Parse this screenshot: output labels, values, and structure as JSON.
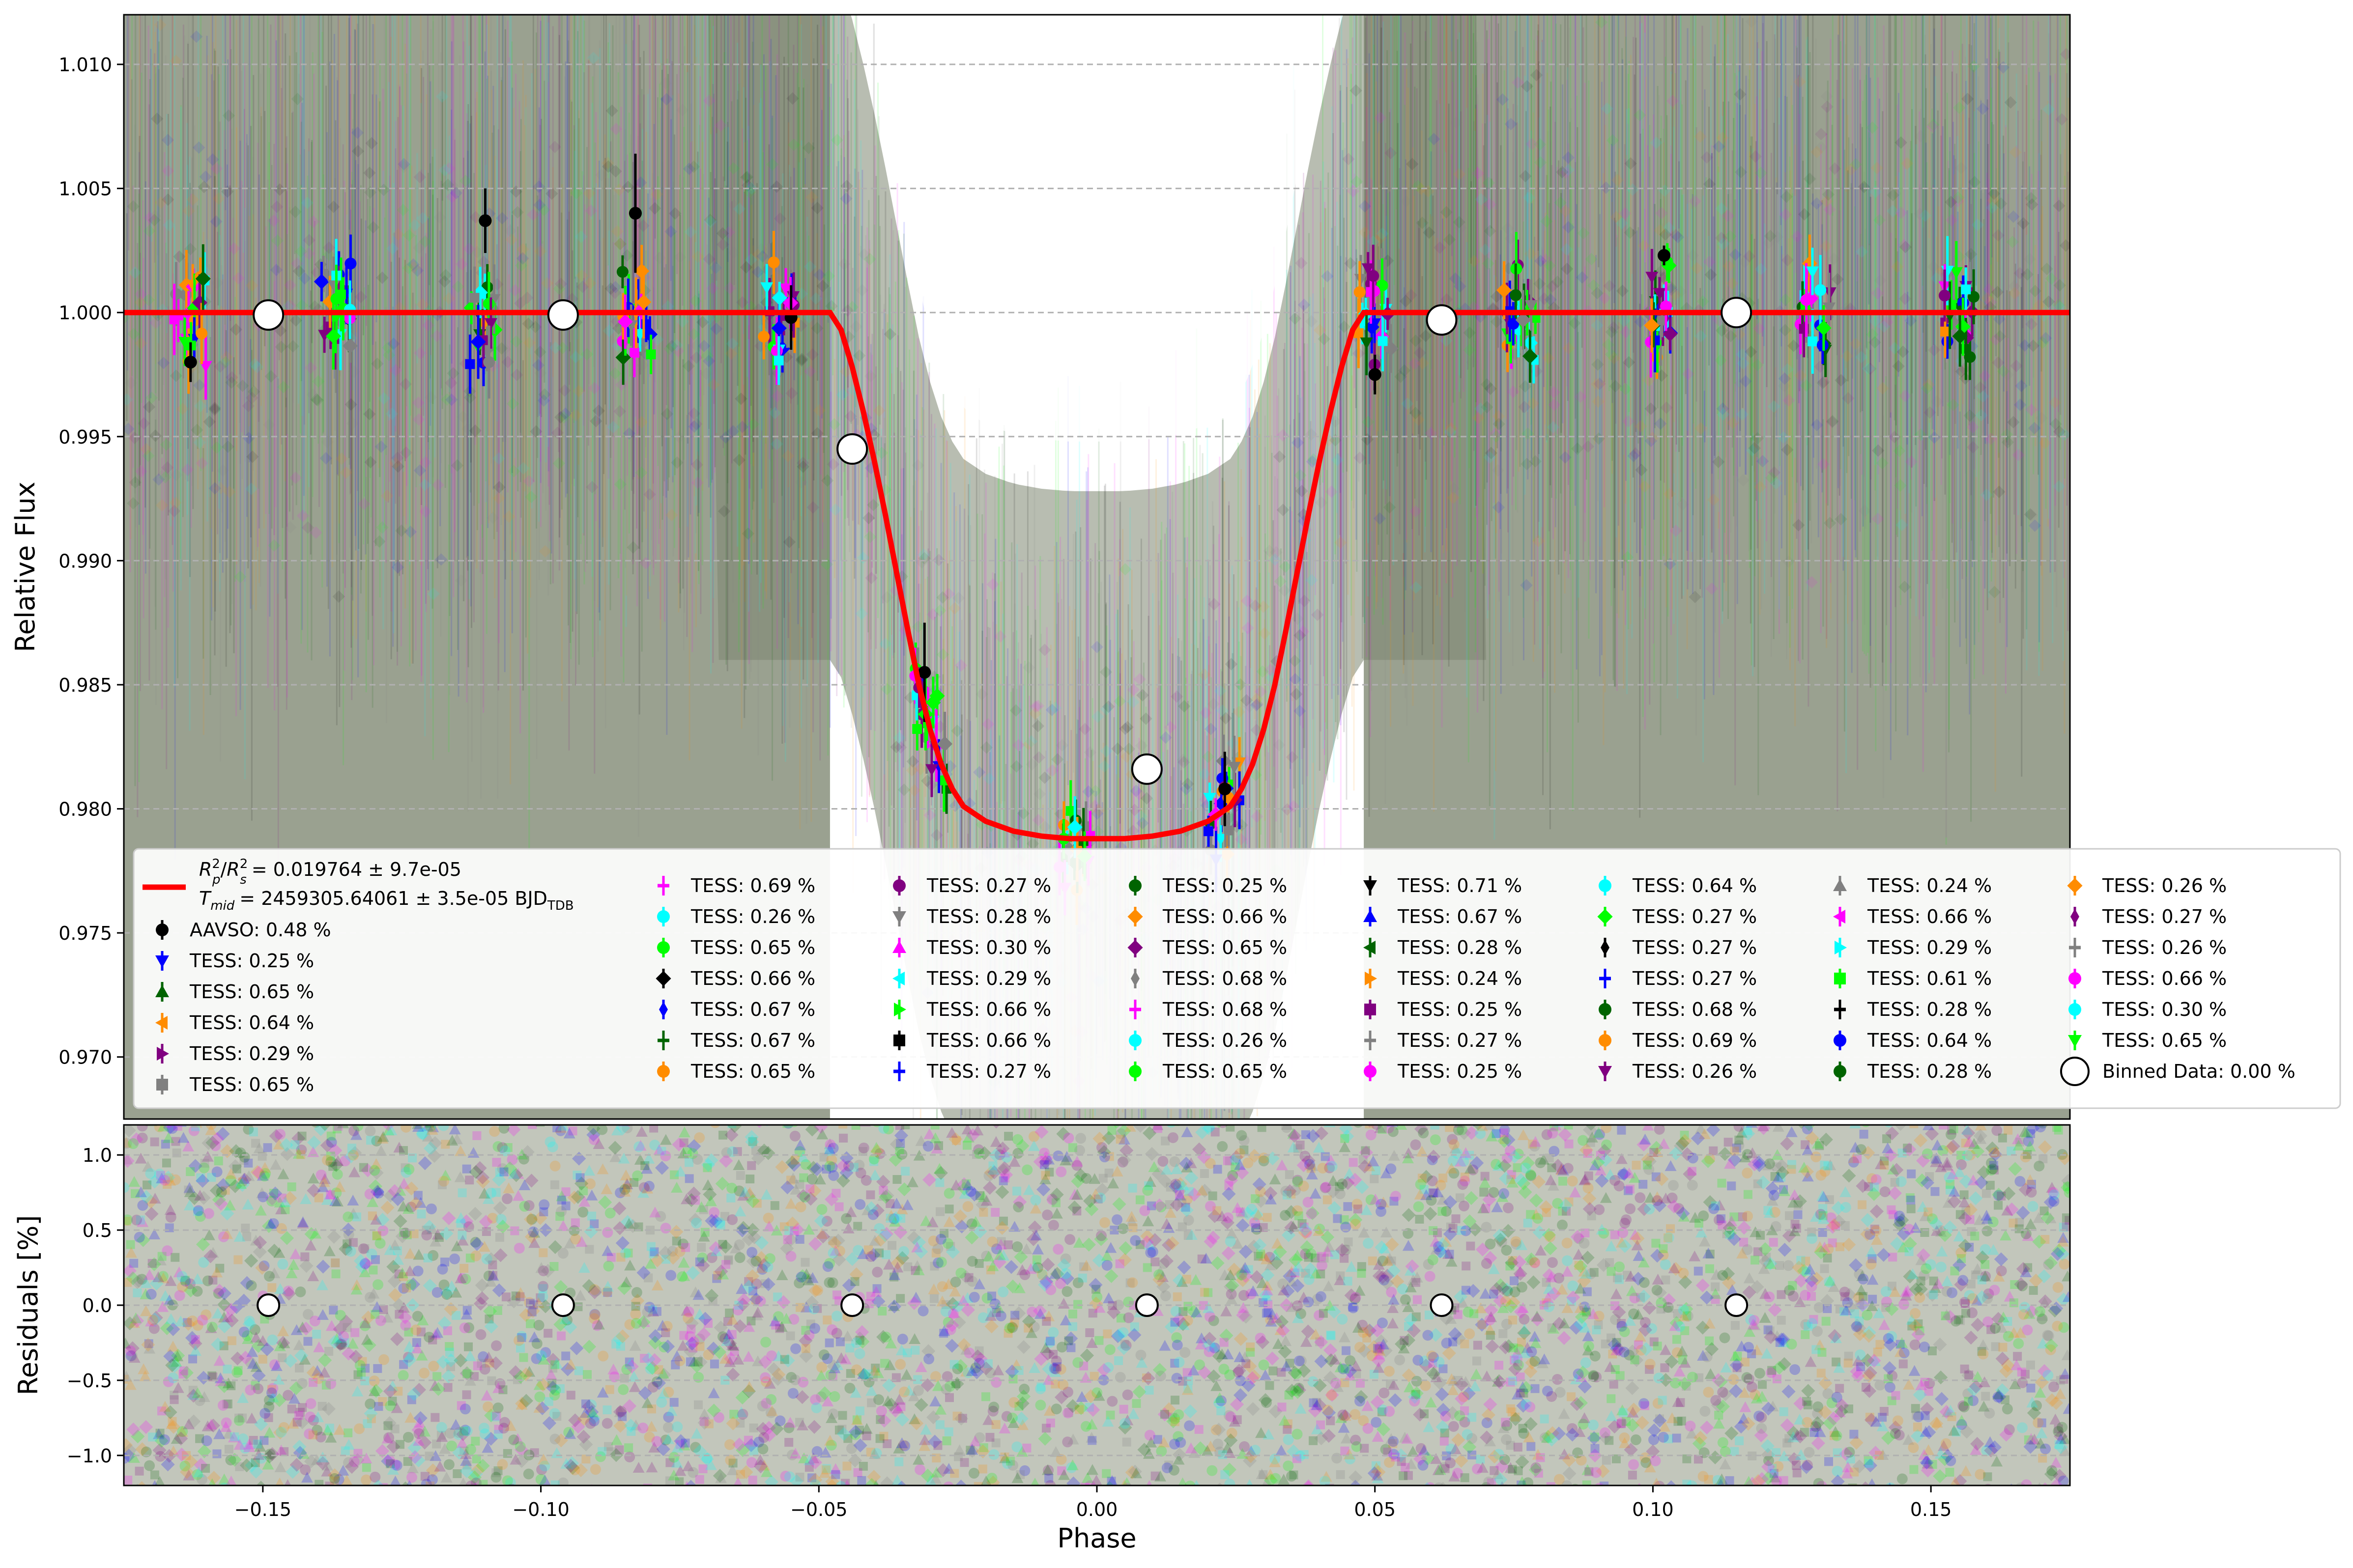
{
  "chart_data": [
    {
      "type": "scatter",
      "panel": "top",
      "xlabel": "",
      "ylabel": "Relative Flux",
      "xlim": [
        -0.175,
        0.175
      ],
      "ylim": [
        0.9675,
        1.012
      ],
      "grid": "horizontal dashed",
      "yticks": [
        "1.010",
        "1.005",
        "1.000",
        "0.995",
        "0.990",
        "0.985",
        "0.980",
        "0.975",
        "0.970"
      ],
      "ytick_values": [
        1.01,
        1.005,
        1.0,
        0.995,
        0.99,
        0.985,
        0.98,
        0.975,
        0.97
      ],
      "model": {
        "name": "transit model",
        "color": "#ff0000",
        "x": [
          -0.175,
          -0.048,
          -0.046,
          -0.044,
          -0.042,
          -0.04,
          -0.038,
          -0.036,
          -0.034,
          -0.032,
          -0.03,
          -0.028,
          -0.026,
          -0.024,
          -0.02,
          -0.015,
          -0.01,
          -0.005,
          0.0,
          0.005,
          0.01,
          0.015,
          0.02,
          0.024,
          0.026,
          0.028,
          0.03,
          0.032,
          0.034,
          0.036,
          0.038,
          0.04,
          0.042,
          0.044,
          0.046,
          0.048,
          0.175
        ],
        "y": [
          1.0,
          1.0,
          0.9993,
          0.9978,
          0.996,
          0.994,
          0.9918,
          0.9895,
          0.9872,
          0.985,
          0.9832,
          0.9818,
          0.9808,
          0.9801,
          0.9795,
          0.9791,
          0.9789,
          0.9788,
          0.9788,
          0.9788,
          0.9789,
          0.9791,
          0.9795,
          0.9801,
          0.9808,
          0.9818,
          0.9832,
          0.985,
          0.9872,
          0.9895,
          0.9918,
          0.994,
          0.996,
          0.9978,
          0.9993,
          1.0,
          1.0
        ]
      },
      "binned": {
        "name": "Binned Data",
        "x": [
          -0.149,
          -0.096,
          -0.044,
          0.009,
          0.062,
          0.115
        ],
        "y": [
          0.9999,
          0.9999,
          0.9945,
          0.9816,
          0.9997,
          1.0
        ]
      },
      "phase_groups_x": [
        -0.163,
        -0.137,
        -0.11,
        -0.083,
        -0.057,
        -0.03,
        -0.004,
        0.023,
        0.05,
        0.076,
        0.102,
        0.129,
        0.155
      ],
      "aavso_points": [
        {
          "x": -0.163,
          "y": 0.998,
          "err": 0.0008
        },
        {
          "x": -0.11,
          "y": 1.0037,
          "err": 0.0013
        },
        {
          "x": -0.083,
          "y": 1.004,
          "err": 0.0024
        },
        {
          "x": -0.055,
          "y": 0.9998,
          "err": 0.0013
        },
        {
          "x": -0.031,
          "y": 0.9855,
          "err": 0.002
        },
        {
          "x": 0.023,
          "y": 0.9808,
          "err": 0.0015
        },
        {
          "x": 0.05,
          "y": 0.9975,
          "err": 0.0008
        },
        {
          "x": 0.102,
          "y": 1.0023,
          "err": 0.0004
        }
      ]
    },
    {
      "type": "scatter",
      "panel": "bottom",
      "xlabel": "Phase",
      "ylabel": "Residuals [%]",
      "xlim": [
        -0.175,
        0.175
      ],
      "ylim": [
        -1.2,
        1.2
      ],
      "grid": "horizontal dashed",
      "xticks": [
        "−0.15",
        "−0.10",
        "−0.05",
        "0.00",
        "0.05",
        "0.10",
        "0.15"
      ],
      "xtick_values": [
        -0.15,
        -0.1,
        -0.05,
        0.0,
        0.05,
        0.1,
        0.15
      ],
      "yticks": [
        "1.0",
        "0.5",
        "0.0",
        "−0.5",
        "−1.0"
      ],
      "ytick_values": [
        1.0,
        0.5,
        0.0,
        -0.5,
        -1.0
      ],
      "binned_residuals": {
        "x": [
          -0.149,
          -0.096,
          -0.044,
          0.009,
          0.062,
          0.115
        ],
        "y": [
          0,
          0,
          0,
          0,
          0,
          0
        ]
      }
    }
  ],
  "legend": {
    "placement": "lower center of top panel",
    "model_line_1": "= 0.019764 ± 9.7e-05",
    "model_line_2": "= 2459305.64061 ± 3.5e-05 BJD",
    "model_line_2_sub": "TDB",
    "model_line_1_math": {
      "r": "R",
      "p": "p",
      "s": "s",
      "two": "2",
      "slash": "/"
    },
    "model_line_2_math": {
      "t": "T",
      "mid": "mid"
    },
    "columns": [
      [
        {
          "label": "AAVSO: 0.48 %",
          "color": "#000000",
          "marker": "circle"
        },
        {
          "label": "TESS: 0.25 %",
          "color": "#0000ff",
          "marker": "tri-down"
        },
        {
          "label": "TESS: 0.65 %",
          "color": "#006400",
          "marker": "tri-up"
        },
        {
          "label": "TESS: 0.64 %",
          "color": "#ff8c00",
          "marker": "tri-left"
        },
        {
          "label": "TESS: 0.29 %",
          "color": "#800080",
          "marker": "tri-right"
        },
        {
          "label": "TESS: 0.65 %",
          "color": "#808080",
          "marker": "square"
        }
      ],
      [
        {
          "label": "TESS: 0.69 %",
          "color": "#ff00ff",
          "marker": "plus"
        },
        {
          "label": "TESS: 0.26 %",
          "color": "#00ffff",
          "marker": "circle"
        },
        {
          "label": "TESS: 0.65 %",
          "color": "#00ff00",
          "marker": "circle"
        },
        {
          "label": "TESS: 0.66 %",
          "color": "#000000",
          "marker": "diamond"
        },
        {
          "label": "TESS: 0.67 %",
          "color": "#0000ff",
          "marker": "thin-diamond"
        },
        {
          "label": "TESS: 0.67 %",
          "color": "#006400",
          "marker": "plus"
        },
        {
          "label": "TESS: 0.65 %",
          "color": "#ff8c00",
          "marker": "octagon"
        }
      ],
      [
        {
          "label": "TESS: 0.27 %",
          "color": "#800080",
          "marker": "circle"
        },
        {
          "label": "TESS: 0.28 %",
          "color": "#808080",
          "marker": "tri-down"
        },
        {
          "label": "TESS: 0.30 %",
          "color": "#ff00ff",
          "marker": "tri-up"
        },
        {
          "label": "TESS: 0.29 %",
          "color": "#00ffff",
          "marker": "tri-left"
        },
        {
          "label": "TESS: 0.66 %",
          "color": "#00ff00",
          "marker": "tri-right"
        },
        {
          "label": "TESS: 0.66 %",
          "color": "#000000",
          "marker": "square"
        },
        {
          "label": "TESS: 0.27 %",
          "color": "#0000ff",
          "marker": "plus"
        }
      ],
      [
        {
          "label": "TESS: 0.25 %",
          "color": "#006400",
          "marker": "circle"
        },
        {
          "label": "TESS: 0.66 %",
          "color": "#ff8c00",
          "marker": "diamond"
        },
        {
          "label": "TESS: 0.65 %",
          "color": "#800080",
          "marker": "diamond"
        },
        {
          "label": "TESS: 0.68 %",
          "color": "#808080",
          "marker": "thin-diamond"
        },
        {
          "label": "TESS: 0.68 %",
          "color": "#ff00ff",
          "marker": "plus"
        },
        {
          "label": "TESS: 0.26 %",
          "color": "#00ffff",
          "marker": "octagon"
        },
        {
          "label": "TESS: 0.65 %",
          "color": "#00ff00",
          "marker": "circle"
        }
      ],
      [
        {
          "label": "TESS: 0.71 %",
          "color": "#000000",
          "marker": "tri-down"
        },
        {
          "label": "TESS: 0.67 %",
          "color": "#0000ff",
          "marker": "tri-up"
        },
        {
          "label": "TESS: 0.28 %",
          "color": "#006400",
          "marker": "tri-left"
        },
        {
          "label": "TESS: 0.24 %",
          "color": "#ff8c00",
          "marker": "tri-right"
        },
        {
          "label": "TESS: 0.25 %",
          "color": "#800080",
          "marker": "square"
        },
        {
          "label": "TESS: 0.27 %",
          "color": "#808080",
          "marker": "plus"
        },
        {
          "label": "TESS: 0.25 %",
          "color": "#ff00ff",
          "marker": "circle"
        }
      ],
      [
        {
          "label": "TESS: 0.64 %",
          "color": "#00ffff",
          "marker": "circle"
        },
        {
          "label": "TESS: 0.27 %",
          "color": "#00ff00",
          "marker": "diamond"
        },
        {
          "label": "TESS: 0.27 %",
          "color": "#000000",
          "marker": "thin-diamond"
        },
        {
          "label": "TESS: 0.27 %",
          "color": "#0000ff",
          "marker": "plus"
        },
        {
          "label": "TESS: 0.68 %",
          "color": "#006400",
          "marker": "octagon"
        },
        {
          "label": "TESS: 0.69 %",
          "color": "#ff8c00",
          "marker": "circle"
        },
        {
          "label": "TESS: 0.26 %",
          "color": "#800080",
          "marker": "tri-down"
        }
      ],
      [
        {
          "label": "TESS: 0.24 %",
          "color": "#808080",
          "marker": "tri-up"
        },
        {
          "label": "TESS: 0.66 %",
          "color": "#ff00ff",
          "marker": "tri-left"
        },
        {
          "label": "TESS: 0.29 %",
          "color": "#00ffff",
          "marker": "tri-right"
        },
        {
          "label": "TESS: 0.61 %",
          "color": "#00ff00",
          "marker": "square"
        },
        {
          "label": "TESS: 0.28 %",
          "color": "#000000",
          "marker": "plus"
        },
        {
          "label": "TESS: 0.64 %",
          "color": "#0000ff",
          "marker": "circle"
        },
        {
          "label": "TESS: 0.28 %",
          "color": "#006400",
          "marker": "circle"
        }
      ],
      [
        {
          "label": "TESS: 0.26 %",
          "color": "#ff8c00",
          "marker": "diamond"
        },
        {
          "label": "TESS: 0.27 %",
          "color": "#800080",
          "marker": "thin-diamond"
        },
        {
          "label": "TESS: 0.26 %",
          "color": "#808080",
          "marker": "plus"
        },
        {
          "label": "TESS: 0.66 %",
          "color": "#ff00ff",
          "marker": "octagon"
        },
        {
          "label": "TESS: 0.30 %",
          "color": "#00ffff",
          "marker": "circle"
        },
        {
          "label": "TESS: 0.65 %",
          "color": "#00ff00",
          "marker": "tri-down"
        },
        {
          "label": "Binned Data: 0.00 %",
          "color": "#ffffff",
          "marker": "big-circle"
        }
      ]
    ]
  },
  "palette": [
    "#000000",
    "#0000ff",
    "#006400",
    "#ff8c00",
    "#800080",
    "#808080",
    "#ff00ff",
    "#00ffff",
    "#00ff00"
  ]
}
